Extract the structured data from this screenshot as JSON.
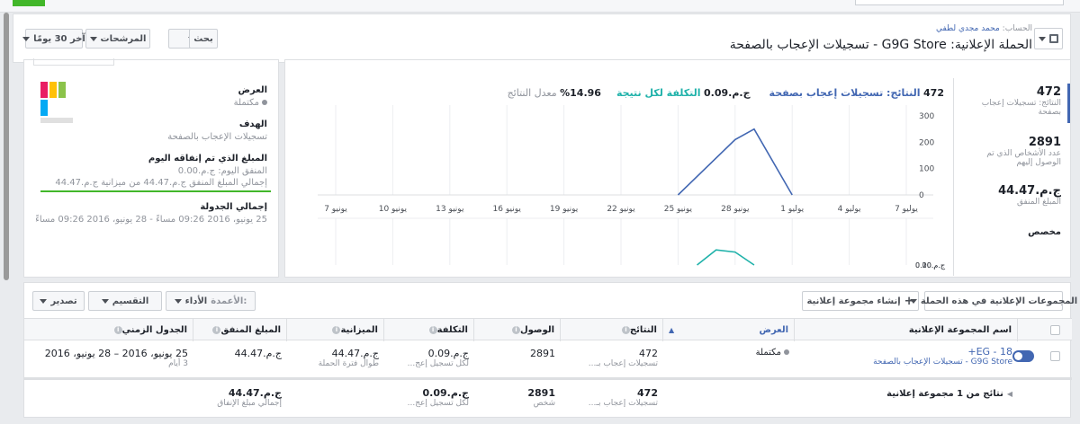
{
  "topbar": {
    "accent": "#42b72a"
  },
  "header": {
    "account_label": "الحساب:",
    "account_name": "محمد مجدي لطفي",
    "campaign_title": "الحملة الإعلانية: G9G Store - تسجيلات الإعجاب بالصفحة",
    "date_range_label": "آخر 30 يومًا",
    "filters_label": "المرشحات",
    "search_label": "بحث"
  },
  "stats": {
    "results_value": "472",
    "results_label": "النتائج: تسجيلات إعجاب بصفحة",
    "reach_value": "2891",
    "reach_label": "عدد الأشخاص الذي تم الوصول إليهم",
    "spent_value": "ج.م.44.47",
    "spent_label": "المبلغ المنفق",
    "custom_label": "مخصص"
  },
  "chart_header": {
    "results_count": "472",
    "results_label": "النتائج: تسجيلات إعجاب بصفحة",
    "cost_value": "ج.م.0.09",
    "cost_label": "التكلفة لكل نتيجة",
    "rate_value": "14.96%",
    "rate_label": "معدل النتائج"
  },
  "chart_data": [
    {
      "type": "line",
      "x": [
        "يونيو 7",
        "يونيو 10",
        "يونيو 13",
        "يونيو 16",
        "يونيو 19",
        "يونيو 22",
        "يونيو 25",
        "يونيو 28",
        "يوليو 1",
        "يوليو 4",
        "يوليو 7"
      ],
      "series": [
        {
          "points": [
            [
              "يونيو 25",
              0
            ],
            [
              "يونيو 28",
              210
            ],
            [
              "يونيو 29",
              250
            ],
            [
              "يوليو 1",
              0
            ]
          ]
        }
      ],
      "yticks": [
        "300",
        "200",
        "100",
        "0"
      ],
      "ylim": [
        0,
        300
      ],
      "color": "#4267b2"
    },
    {
      "type": "line",
      "series": [
        {
          "points": [
            [
              "يونيو 26",
              0.0
            ],
            [
              "يونيو 27",
              0.07
            ],
            [
              "يونيو 28",
              0.06
            ],
            [
              "يونيو 29",
              0.0
            ]
          ]
        }
      ],
      "yticks": [
        "ج.م.0.20",
        "ج.م.0.10",
        "ج.م.0.00"
      ],
      "ylim": [
        0,
        0.2
      ],
      "color": "#20b2aa"
    }
  ],
  "details": {
    "ad_label": "العرض",
    "ad_status": "مكتملة",
    "objective_label": "الهدف",
    "objective_value": "تسجيلات الإعجاب بالصفحة",
    "spent_today_label": "المبلغ الذي تم إنفاقه اليوم",
    "spent_today_value": "المنفق اليوم: ج.م.0.00",
    "budget_progress": "إجمالي المبلغ المنفق ج.م.44.47 من ميزانية ج.م.44.47",
    "budget_fraction": 1.0,
    "schedule_label": "إجمالي الجدولة",
    "schedule_value": "25 يونيو، 2016 09:26 مساءً - 28 يونيو، 2016 09:26 مساءً"
  },
  "table_toolbar": {
    "adsets_in_campaign": "المجموعات الإعلانية في هذه الحملة",
    "create_adset": "إنشاء مجموعة إعلانية",
    "columns_label": "الأعمدة:",
    "columns_value": "الأداء",
    "breakdown_label": "التقسيم",
    "export_label": "تصدير"
  },
  "table": {
    "headers": [
      "اسم المجموعة الإعلانية",
      "العرض",
      "النتائج",
      "الوصول",
      "التكلفة",
      "الميزانية",
      "المبلغ المنفق",
      "الجدول الزمني"
    ],
    "row": {
      "name": "EG - 18+",
      "campaign": "G9G Store - تسجيلات الإعجاب بالصفحة",
      "delivery": "مكتملة",
      "results": "472",
      "results_sub": "تسجيلات إعجاب بـ...",
      "reach": "2891",
      "cost": "ج.م.0.09",
      "cost_sub": "لكل تسجيل إعج...",
      "budget": "ج.م.44.47",
      "budget_sub": "طوال فترة الحملة",
      "spent": "ج.م.44.47",
      "schedule": "25 يونيو، 2016 – 28 يونيو، 2016",
      "schedule_sub": "3 أيام"
    },
    "summary": {
      "label": "نتائج من 1 مجموعة إعلانية",
      "results": "472",
      "results_sub": "تسجيلات إعجاب بـ...",
      "reach": "2891",
      "reach_sub": "شخص",
      "cost": "ج.م.0.09",
      "cost_sub": "لكل تسجيل إعج...",
      "spent": "ج.م.44.47",
      "spent_sub": "إجمالي مبلغ الإنفاق"
    }
  }
}
